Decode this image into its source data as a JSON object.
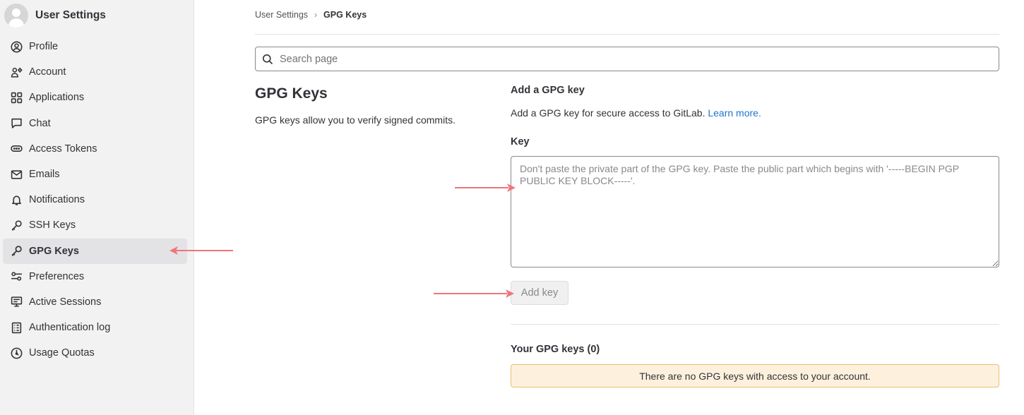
{
  "sidebar": {
    "title": "User Settings",
    "items": [
      {
        "label": "Profile",
        "icon": "profile-icon"
      },
      {
        "label": "Account",
        "icon": "account-icon"
      },
      {
        "label": "Applications",
        "icon": "applications-icon"
      },
      {
        "label": "Chat",
        "icon": "chat-icon"
      },
      {
        "label": "Access Tokens",
        "icon": "token-icon"
      },
      {
        "label": "Emails",
        "icon": "mail-icon"
      },
      {
        "label": "Notifications",
        "icon": "bell-icon"
      },
      {
        "label": "SSH Keys",
        "icon": "key-icon"
      },
      {
        "label": "GPG Keys",
        "icon": "key-icon",
        "active": true
      },
      {
        "label": "Preferences",
        "icon": "preferences-icon"
      },
      {
        "label": "Active Sessions",
        "icon": "monitor-icon"
      },
      {
        "label": "Authentication log",
        "icon": "log-icon"
      },
      {
        "label": "Usage Quotas",
        "icon": "quota-icon"
      }
    ]
  },
  "breadcrumb": {
    "parent": "User Settings",
    "separator": "›",
    "current": "GPG Keys"
  },
  "search": {
    "placeholder": "Search page"
  },
  "section": {
    "title": "GPG Keys",
    "description": "GPG keys allow you to verify signed commits."
  },
  "form": {
    "heading": "Add a GPG key",
    "description": "Add a GPG key for secure access to GitLab.",
    "learn_more": "Learn more.",
    "key_label": "Key",
    "key_placeholder": "Don't paste the private part of the GPG key. Paste the public part which begins with '-----BEGIN PGP PUBLIC KEY BLOCK-----'.",
    "submit_label": "Add key"
  },
  "keys_list": {
    "heading": "Your GPG keys (0)",
    "empty_message": "There are no GPG keys with access to your account."
  },
  "colors": {
    "annotation_arrow": "#f0747a",
    "link": "#1f75cb",
    "alert_bg": "#fdf1dd",
    "alert_border": "#e9be74"
  }
}
